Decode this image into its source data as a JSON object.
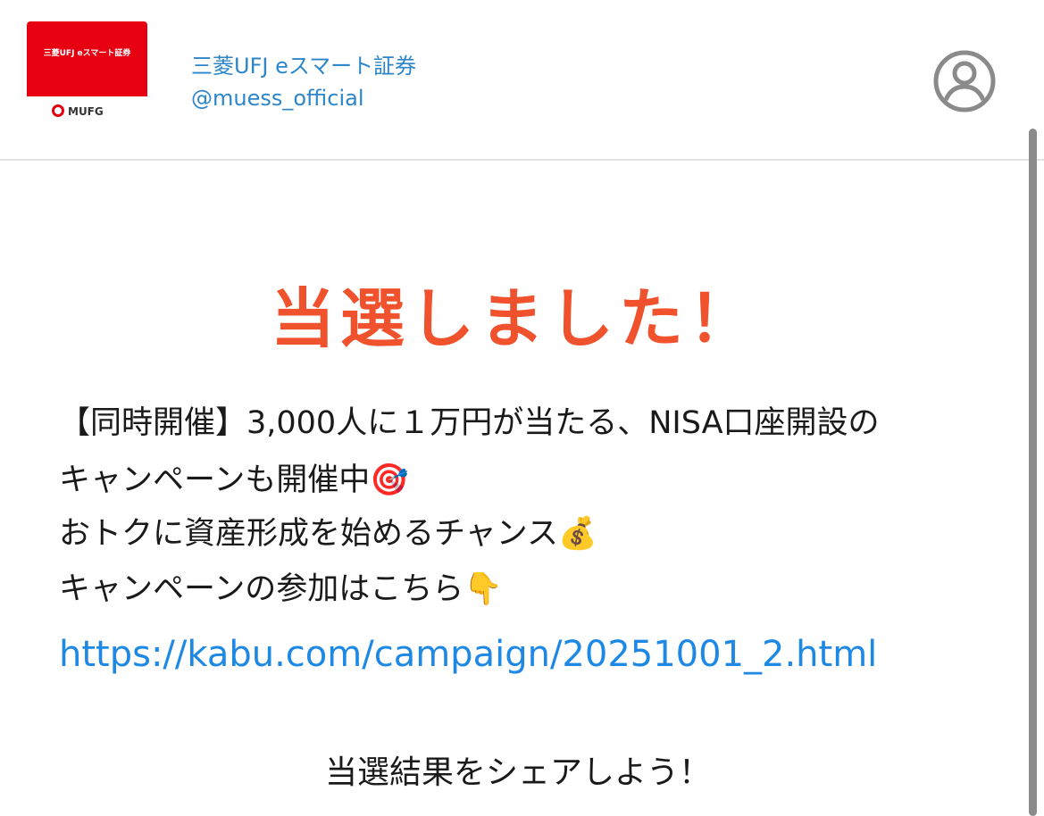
{
  "header": {
    "logo_text": "三菱UFJ eスマート証券",
    "logo_brand": "MUFG",
    "account_name": "三菱UFJ eスマート証券",
    "account_handle": "@muess_official",
    "profile_icon": "user-circle-icon"
  },
  "main": {
    "headline": "当選しました！",
    "body_lines": [
      "【同時開催】3,000人に１万円が当たる、NISA口座開設の",
      "キャンペーンも開催中",
      "おトクに資産形成を始めるチャンス",
      "キャンペーンの参加はこちら"
    ],
    "emojis": [
      "🎯",
      "💰",
      "👇"
    ],
    "link": "https://kabu.com/campaign/20251001_2.html",
    "share_text": "当選結果をシェアしよう！"
  },
  "colors": {
    "accent": "#f0522d",
    "link": "#1e88e5",
    "brand": "#e60012",
    "header_text": "#2d86c9"
  }
}
